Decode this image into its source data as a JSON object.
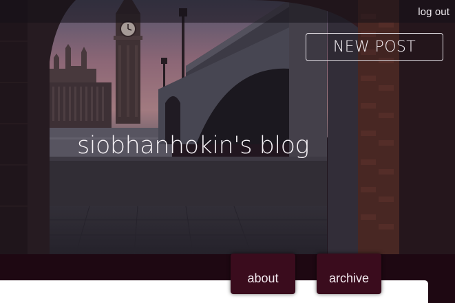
{
  "topbar": {
    "logout_label": "log out"
  },
  "actions": {
    "new_post_label": "NEW POST"
  },
  "blog": {
    "title": "siobhanhokin's blog"
  },
  "nav": {
    "tabs": [
      {
        "label": "about"
      },
      {
        "label": "archive"
      }
    ]
  },
  "colors": {
    "band": "#1e0812",
    "tab": "#3a0c1d",
    "panel": "#ffffff",
    "text": "#f4f0f4"
  },
  "icons": [
    "clock-tower-icon"
  ]
}
